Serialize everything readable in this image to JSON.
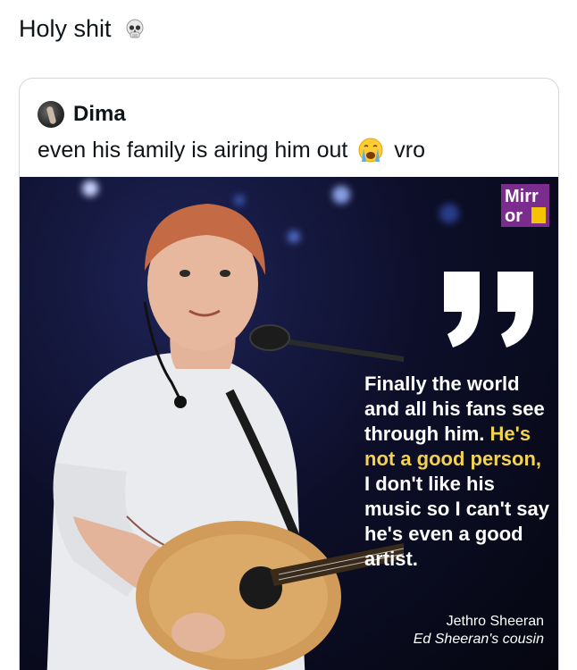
{
  "post": {
    "text": "Holy shit",
    "emoji_icon": "skull-icon"
  },
  "quoted_post": {
    "author": "Dima",
    "text_before": "even his family is airing him out",
    "emoji_icon": "loudly-crying-face-icon",
    "text_after": "vro"
  },
  "media": {
    "logo_line1": "Mirr",
    "logo_line2": "or",
    "quote_marks_icon": "closing-quote-icon",
    "quote_part1": "Finally the world and all his fans see through him.",
    "quote_highlight": "He's not a good person,",
    "quote_part2": "I don't like his music so I can't say he's even a good artist.",
    "attribution_name": "Jethro Sheeran",
    "attribution_role": "Ed Sheeran's cousin",
    "colors": {
      "background": "#0d0f2a",
      "quote_text": "#ffffff",
      "highlight": "#f3d24f",
      "logo_bg": "#7b2d8e",
      "logo_accent": "#f5c400"
    }
  }
}
